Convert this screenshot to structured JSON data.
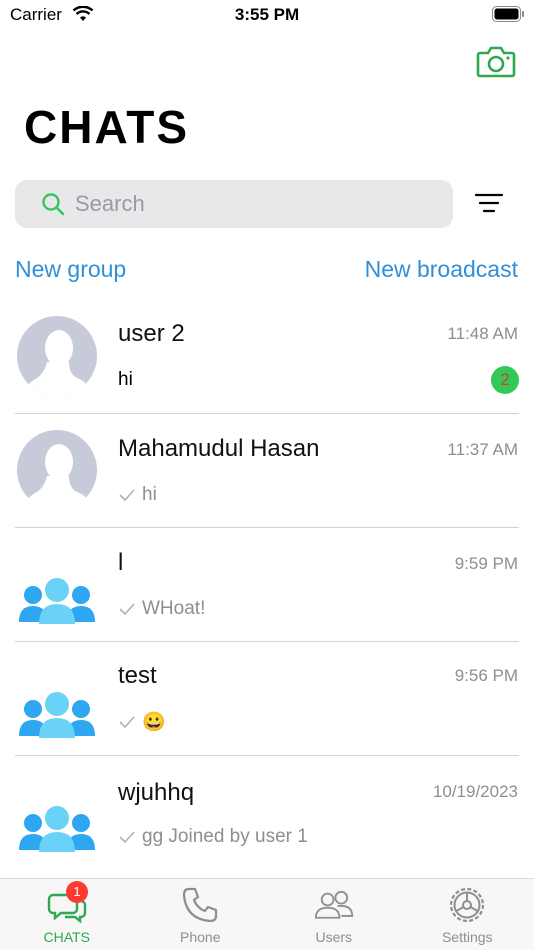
{
  "status_bar": {
    "carrier": "Carrier",
    "time": "3:55 PM"
  },
  "header": {
    "title": "CHATS",
    "camera_icon": "camera-icon"
  },
  "search": {
    "placeholder": "Search",
    "value": ""
  },
  "actions": {
    "new_group": "New group",
    "new_broadcast": "New broadcast"
  },
  "chats": [
    {
      "name": "user 2",
      "time": "11:48 AM",
      "preview": "hi",
      "unread": "2",
      "avatar": "person-avatar"
    },
    {
      "name": "Mahamudul Hasan",
      "time": "11:37 AM",
      "preview": "hi",
      "avatar": "person-avatar"
    },
    {
      "name": "l",
      "time": "9:59 PM",
      "preview": "WHoat!",
      "avatar": "group-avatar"
    },
    {
      "name": "test",
      "time": "9:56 PM",
      "preview": "😀",
      "avatar": "group-avatar"
    },
    {
      "name": "wjuhhq",
      "time": "10/19/2023",
      "preview": "gg Joined by user 1",
      "avatar": "group-avatar"
    }
  ],
  "tabs": [
    {
      "label": "CHATS",
      "icon": "chat-bubbles-icon",
      "badge": "1",
      "active": true
    },
    {
      "label": "Phone",
      "icon": "phone-icon"
    },
    {
      "label": "Users",
      "icon": "users-icon"
    },
    {
      "label": "Settings",
      "icon": "gear-icon"
    }
  ],
  "colors": {
    "accent_green": "#2fa84f",
    "link_blue": "#2f8fd8",
    "badge_green": "#34c759",
    "badge_red": "#ff3b30",
    "group_blue": "#2fa6f2"
  }
}
